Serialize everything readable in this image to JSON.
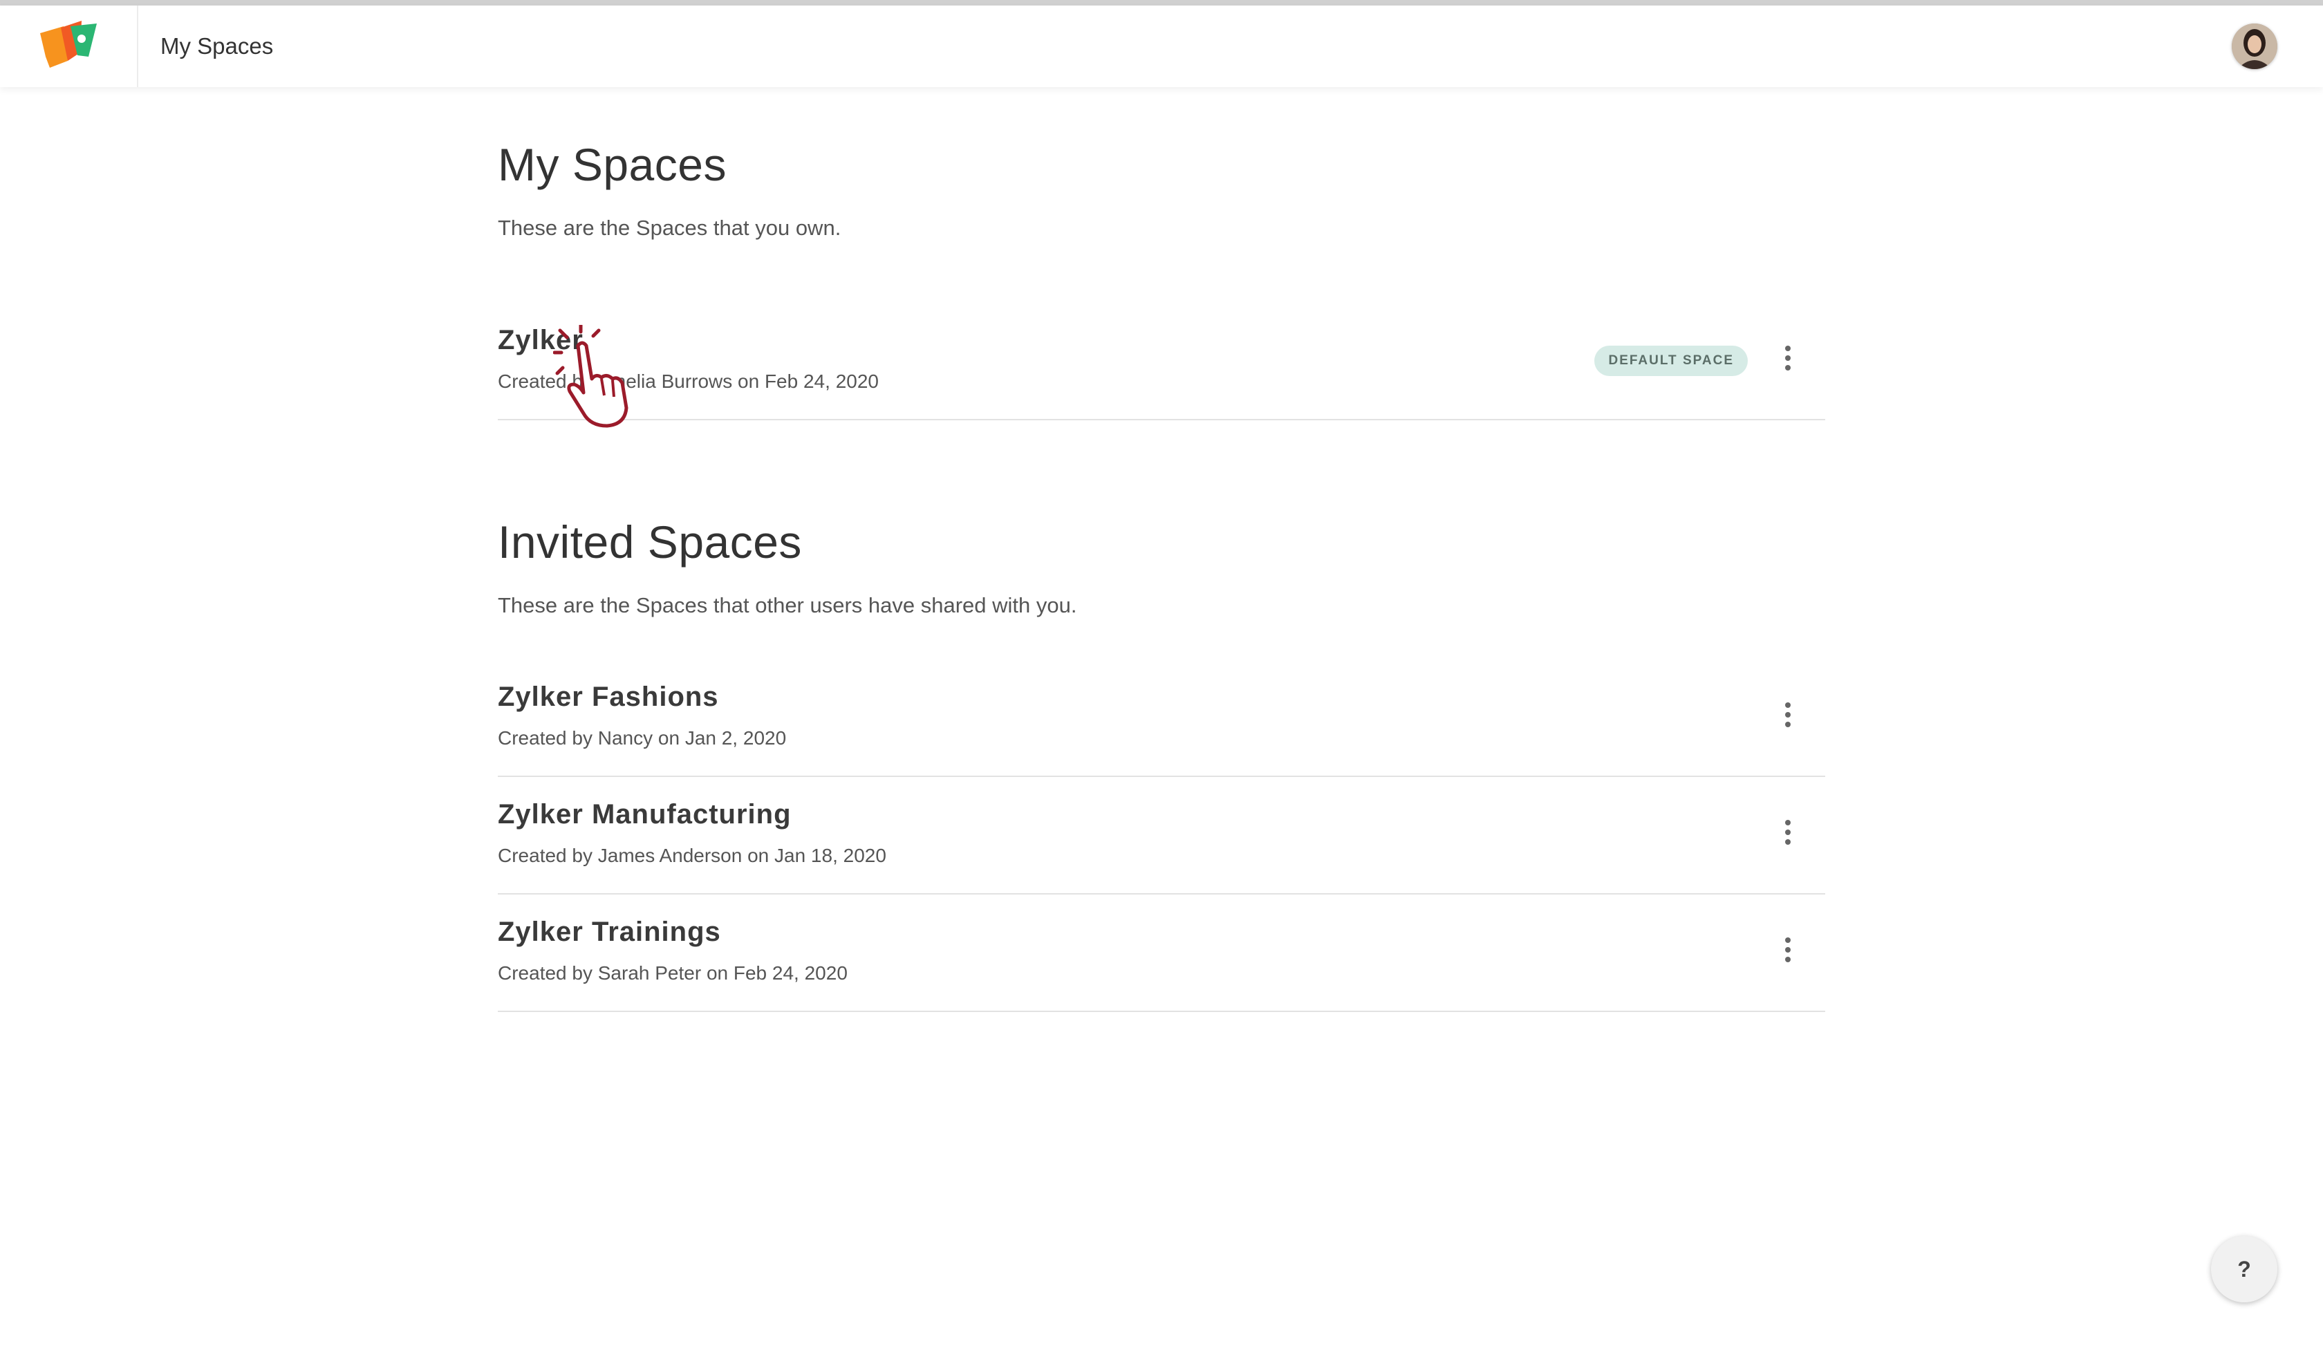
{
  "header": {
    "title": "My Spaces"
  },
  "my_spaces": {
    "title": "My Spaces",
    "subtitle": "These are the Spaces that you own.",
    "items": [
      {
        "name": "Zylker",
        "meta": "Created by Amelia Burrows on Feb 24, 2020",
        "badge": "DEFAULT SPACE"
      }
    ]
  },
  "invited_spaces": {
    "title": "Invited Spaces",
    "subtitle": "These are the Spaces that other users have shared with you.",
    "items": [
      {
        "name": "Zylker Fashions",
        "meta": "Created by Nancy on Jan 2, 2020"
      },
      {
        "name": "Zylker Manufacturing",
        "meta": "Created by James Anderson on Jan 18, 2020"
      },
      {
        "name": "Zylker Trainings",
        "meta": "Created by Sarah Peter on Feb 24, 2020"
      }
    ]
  },
  "help": {
    "label": "?"
  },
  "icons": {
    "logo": "app-logo-icon",
    "avatar": "user-avatar",
    "more": "more-vertical-icon",
    "cursor": "hand-pointer-cursor-icon"
  },
  "colors": {
    "badge_bg": "#d6ebe6",
    "badge_text": "#5b6e68",
    "logo_orange": "#f7931e",
    "logo_green": "#2bb673",
    "cursor": "#9b1b2a"
  }
}
